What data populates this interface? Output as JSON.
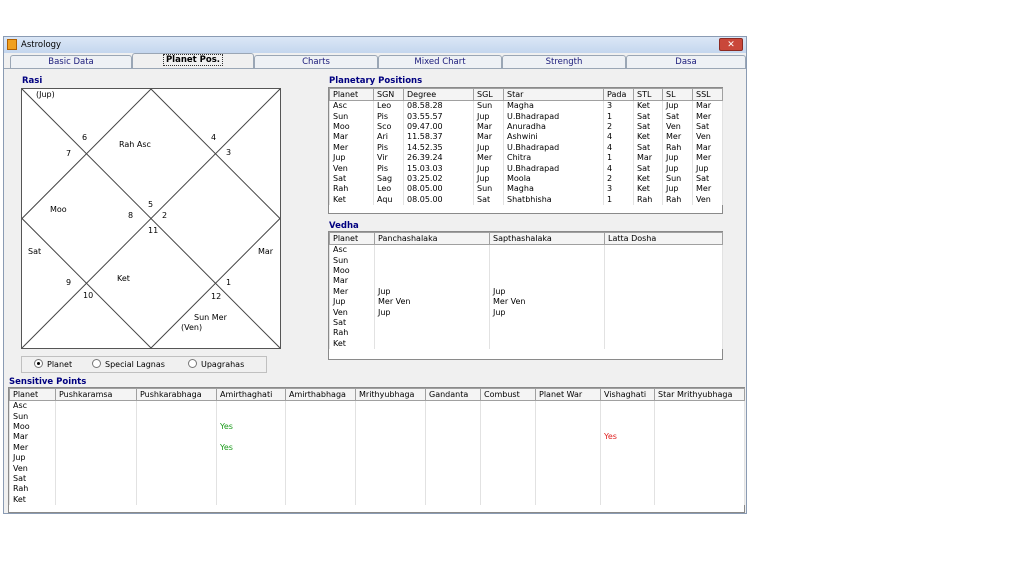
{
  "window": {
    "title": "Astrology",
    "close_glyph": "✕"
  },
  "tabs": [
    {
      "label": "Basic Data"
    },
    {
      "label": "Planet Pos."
    },
    {
      "label": "Charts"
    },
    {
      "label": "Mixed Chart"
    },
    {
      "label": "Strength"
    },
    {
      "label": "Dasa"
    }
  ],
  "rasi": {
    "title": "Rasi",
    "cells": {
      "jup": "(Jup)",
      "n6": "6",
      "n7": "7",
      "rah_asc": "Rah  Asc",
      "n4": "4",
      "n3": "3",
      "moo": "Moo",
      "n5": "5",
      "n8": "8",
      "n2": "2",
      "n11": "11",
      "sat": "Sat",
      "mar": "Mar",
      "n9": "9",
      "ket": "Ket",
      "n10": "10",
      "n1": "1",
      "n12": "12",
      "sun_mer": "Sun  Mer",
      "ven": "(Ven)"
    }
  },
  "radio": {
    "options": [
      "Planet",
      "Special Lagnas",
      "Upagrahas"
    ],
    "selected": "Planet"
  },
  "planetary_positions": {
    "title": "Planetary Positions",
    "columns": [
      "Planet",
      "SGN",
      "Degree",
      "SGL",
      "Star",
      "Pada",
      "STL",
      "SL",
      "SSL"
    ],
    "rows": [
      [
        "Asc",
        "Leo",
        "08.58.28",
        "Sun",
        "Magha",
        "3",
        "Ket",
        "Jup",
        "Mar"
      ],
      [
        "Sun",
        "Pis",
        "03.55.57",
        "Jup",
        "U.Bhadrapad",
        "1",
        "Sat",
        "Sat",
        "Mer"
      ],
      [
        "Moo",
        "Sco",
        "09.47.00",
        "Mar",
        "Anuradha",
        "2",
        "Sat",
        "Ven",
        "Sat"
      ],
      [
        "Mar",
        "Ari",
        "11.58.37",
        "Mar",
        "Ashwini",
        "4",
        "Ket",
        "Mer",
        "Ven"
      ],
      [
        "Mer",
        "Pis",
        "14.52.35",
        "Jup",
        "U.Bhadrapad",
        "4",
        "Sat",
        "Rah",
        "Mar"
      ],
      [
        "Jup",
        "Vir",
        "26.39.24",
        "Mer",
        "Chitra",
        "1",
        "Mar",
        "Jup",
        "Mer"
      ],
      [
        "Ven",
        "Pis",
        "15.03.03",
        "Jup",
        "U.Bhadrapad",
        "4",
        "Sat",
        "Jup",
        "Jup"
      ],
      [
        "Sat",
        "Sag",
        "03.25.02",
        "Jup",
        "Moola",
        "2",
        "Ket",
        "Sun",
        "Sat"
      ],
      [
        "Rah",
        "Leo",
        "08.05.00",
        "Sun",
        "Magha",
        "3",
        "Ket",
        "Jup",
        "Mer"
      ],
      [
        "Ket",
        "Aqu",
        "08.05.00",
        "Sat",
        "Shatbhisha",
        "1",
        "Rah",
        "Rah",
        "Ven"
      ]
    ]
  },
  "vedha": {
    "title": "Vedha",
    "columns": [
      "Planet",
      "Panchashalaka",
      "Sapthashalaka",
      "Latta Dosha"
    ],
    "rows": [
      [
        "Asc",
        "",
        "",
        ""
      ],
      [
        "Sun",
        "",
        "",
        ""
      ],
      [
        "Moo",
        "",
        "",
        ""
      ],
      [
        "Mar",
        "",
        "",
        ""
      ],
      [
        "Mer",
        "Jup",
        "Jup",
        ""
      ],
      [
        "Jup",
        "Mer Ven",
        "Mer Ven",
        ""
      ],
      [
        "Ven",
        "Jup",
        "Jup",
        ""
      ],
      [
        "Sat",
        "",
        "",
        ""
      ],
      [
        "Rah",
        "",
        "",
        ""
      ],
      [
        "Ket",
        "",
        "",
        ""
      ]
    ]
  },
  "sensitive_points": {
    "title": "Sensitive Points",
    "columns": [
      "Planet",
      "Pushkaramsa",
      "Pushkarabhaga",
      "Amirthaghati",
      "Amirthabhaga",
      "Mrithyubhaga",
      "Gandanta",
      "Combust",
      "Planet War",
      "Vishaghati",
      "Star Mrithyubhaga"
    ],
    "rows": [
      [
        "Asc",
        "",
        "",
        "",
        "",
        "",
        "",
        "",
        "",
        "",
        ""
      ],
      [
        "Sun",
        "",
        "",
        "",
        "",
        "",
        "",
        "",
        "",
        "",
        ""
      ],
      [
        "Moo",
        "",
        "",
        "Yes",
        "",
        "",
        "",
        "",
        "",
        "",
        ""
      ],
      [
        "Mar",
        "",
        "",
        "",
        "",
        "",
        "",
        "",
        "",
        "Yes",
        ""
      ],
      [
        "Mer",
        "",
        "",
        "Yes",
        "",
        "",
        "",
        "",
        "",
        "",
        ""
      ],
      [
        "Jup",
        "",
        "",
        "",
        "",
        "",
        "",
        "",
        "",
        "",
        ""
      ],
      [
        "Ven",
        "",
        "",
        "",
        "",
        "",
        "",
        "",
        "",
        "",
        ""
      ],
      [
        "Sat",
        "",
        "",
        "",
        "",
        "",
        "",
        "",
        "",
        "",
        ""
      ],
      [
        "Rah",
        "",
        "",
        "",
        "",
        "",
        "",
        "",
        "",
        "",
        ""
      ],
      [
        "Ket",
        "",
        "",
        "",
        "",
        "",
        "",
        "",
        "",
        "",
        ""
      ]
    ]
  },
  "colors": {
    "yes_green": "#1a9a1a",
    "yes_red": "#e02020",
    "section_title": "#000080"
  }
}
